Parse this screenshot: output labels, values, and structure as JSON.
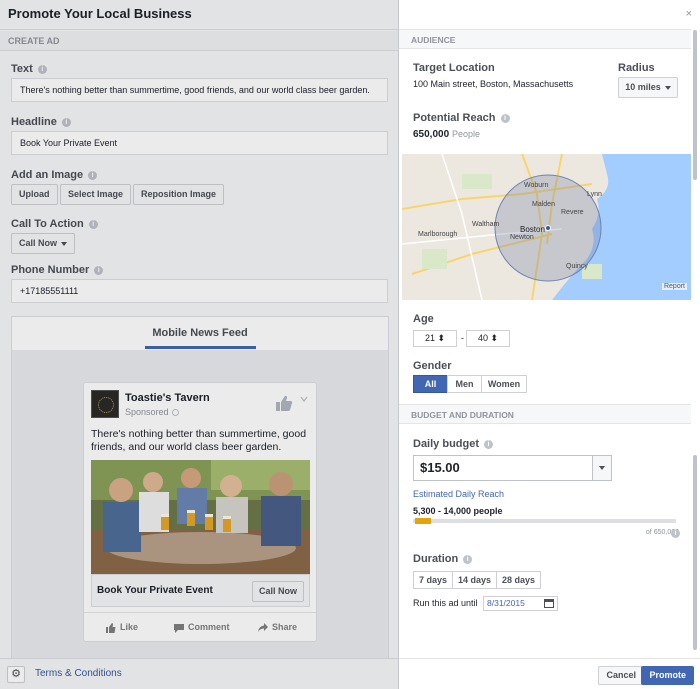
{
  "dialog": {
    "title": "Promote Your Local Business",
    "section": "CREATE AD",
    "close": "×"
  },
  "form": {
    "text_label": "Text",
    "text_value": "There's nothing better than summertime, good friends, and our world class beer garden.",
    "headline_label": "Headline",
    "headline_value": "Book Your Private Event",
    "image_label": "Add an Image",
    "upload": "Upload",
    "select_image": "Select Image",
    "reposition_image": "Reposition Image",
    "cta_label": "Call To Action",
    "cta_value": "Call Now",
    "phone_label": "Phone Number",
    "phone_value": "+17185551111"
  },
  "preview": {
    "tab": "Mobile News Feed",
    "page_name": "Toastie's Tavern",
    "sponsored": "Sponsored",
    "post_text": "There's nothing better than summertime, good friends, and our world class beer garden.",
    "link_title": "Book Your Private Event",
    "cta": "Call Now",
    "like": "Like",
    "comment": "Comment",
    "share": "Share"
  },
  "footer_left": {
    "terms": "Terms & Conditions"
  },
  "audience": {
    "header": "AUDIENCE",
    "target_label": "Target Location",
    "target_value": "100 Main street, Boston, Massachusetts",
    "radius_label": "Radius",
    "radius_value": "10 miles",
    "reach_label": "Potential Reach",
    "reach_value": "650,000",
    "reach_unit": "People",
    "map_labels": [
      "Woburn",
      "Lynn",
      "Malden",
      "Revere",
      "Waltham",
      "Boston",
      "Newton",
      "Marlborough",
      "Quincy"
    ],
    "map_report": "Report",
    "age_label": "Age",
    "age_min": "21",
    "age_max": "40",
    "age_sep": "-",
    "gender_label": "Gender",
    "gender_all": "All",
    "gender_men": "Men",
    "gender_women": "Women"
  },
  "budget": {
    "header": "BUDGET AND DURATION",
    "daily_label": "Daily budget",
    "daily_value": "$15.00",
    "est_label": "Estimated Daily Reach",
    "est_value": "5,300 - 14,000 people",
    "est_max": "of 650,000",
    "reach_fraction_start": 0.008,
    "reach_fraction_end": 0.022,
    "duration_label": "Duration",
    "d7": "7 days",
    "d14": "14 days",
    "d28": "28 days",
    "run_until_label": "Run this ad until",
    "run_until_value": "8/31/2015"
  },
  "actions": {
    "cancel": "Cancel",
    "promote": "Promote"
  },
  "colors": {
    "accent": "#4267b2",
    "reach_bar": "#e5a40c",
    "map_water": "#a3ccff"
  }
}
